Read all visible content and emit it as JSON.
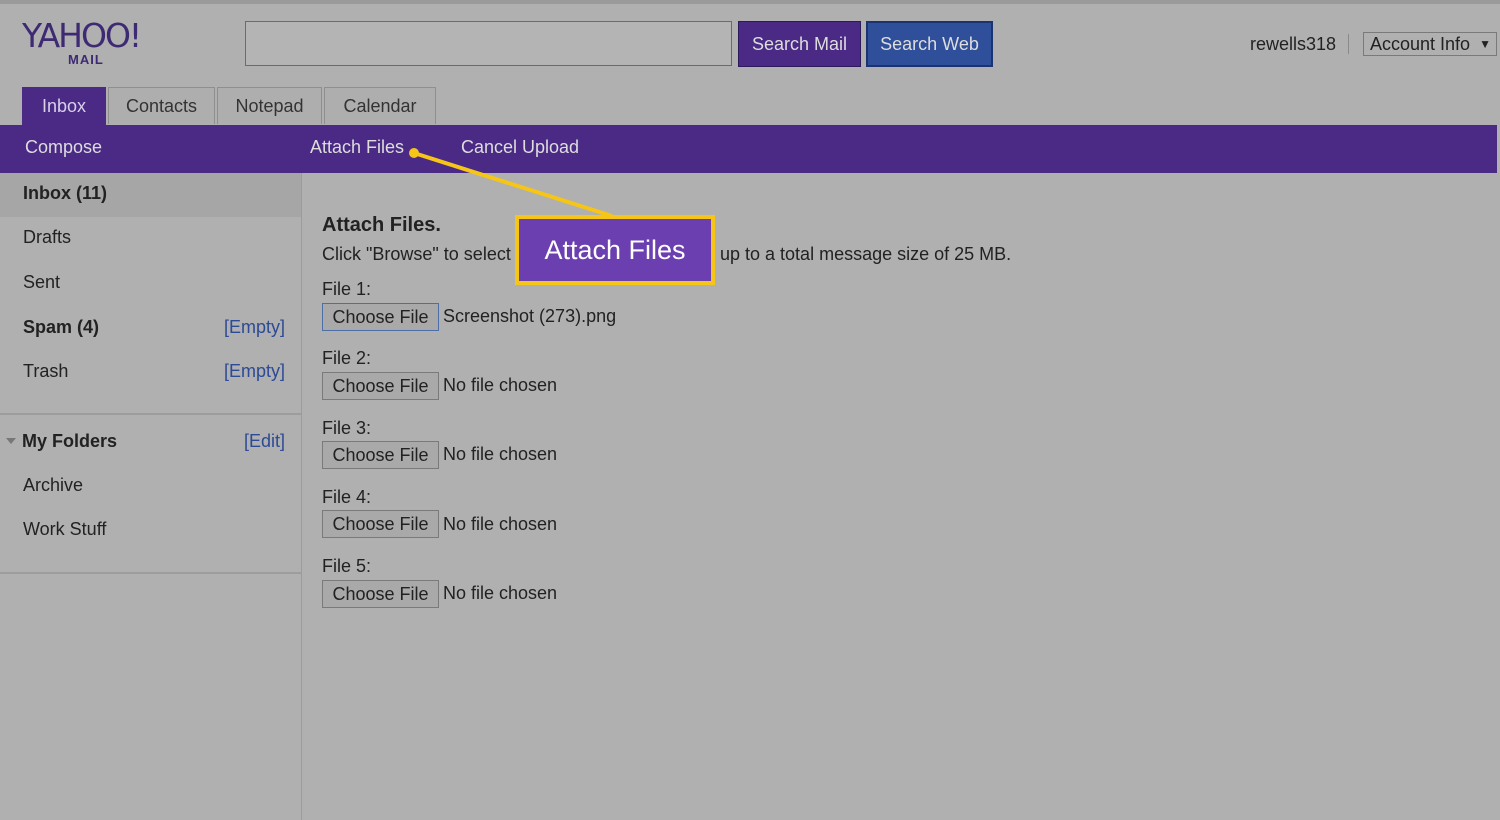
{
  "header": {
    "logo_text": "YAHOO!",
    "logo_sub": "MAIL",
    "search_placeholder": "",
    "search_mail_label": "Search Mail",
    "search_web_label": "Search Web",
    "username": "rewells318",
    "account_menu_label": "Account Info"
  },
  "tabs": [
    {
      "label": "Inbox",
      "active": true
    },
    {
      "label": "Contacts",
      "active": false
    },
    {
      "label": "Notepad",
      "active": false
    },
    {
      "label": "Calendar",
      "active": false
    }
  ],
  "toolbar": {
    "compose_label": "Compose",
    "attach_files_label": "Attach Files",
    "cancel_upload_label": "Cancel Upload"
  },
  "sidebar": {
    "folders": [
      {
        "label": "Inbox (11)",
        "action": ""
      },
      {
        "label": "Drafts",
        "action": ""
      },
      {
        "label": "Sent",
        "action": ""
      },
      {
        "label": "Spam (4)",
        "action": "[Empty]"
      },
      {
        "label": "Trash",
        "action": "[Empty]"
      }
    ],
    "my_folders_label": "My Folders",
    "my_folders_action": "[Edit]",
    "custom_folders": [
      {
        "label": "Archive"
      },
      {
        "label": "Work Stuff"
      }
    ]
  },
  "main": {
    "heading": "Attach Files.",
    "instruction_start": "Click \"Browse\" to select",
    "instruction_end": "up to a total message size of 25 MB.",
    "choose_file_label": "Choose File",
    "files": [
      {
        "label": "File 1:",
        "filename": "Screenshot (273).png"
      },
      {
        "label": "File 2:",
        "filename": "No file chosen"
      },
      {
        "label": "File 3:",
        "filename": "No file chosen"
      },
      {
        "label": "File 4:",
        "filename": "No file chosen"
      },
      {
        "label": "File 5:",
        "filename": "No file chosen"
      }
    ]
  },
  "callout": {
    "text": "Attach Files",
    "color": "#6b3fb0",
    "border_color": "#f5c518"
  },
  "colors": {
    "purple": "#4b2a86",
    "blue": "#2f4f9a",
    "link": "#2c4a96"
  }
}
